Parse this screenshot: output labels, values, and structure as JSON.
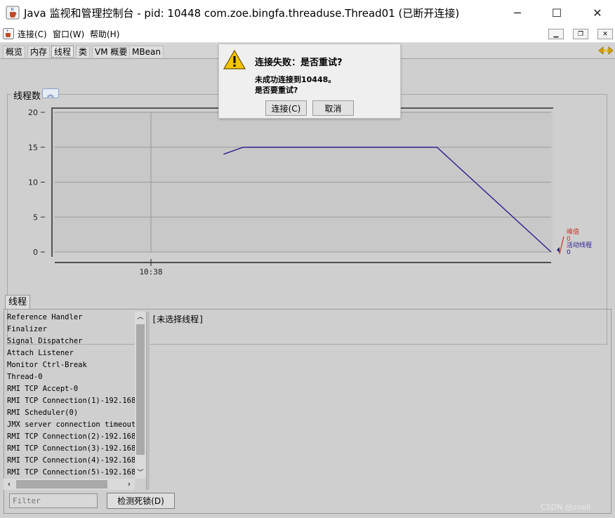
{
  "window": {
    "title": "Java 监视和管理控制台 - pid: 10448 com.zoe.bingfa.threaduse.Thread01 (已断开连接)",
    "minimize": "─",
    "maximize": "☐",
    "close": "✕"
  },
  "menu": {
    "items": [
      "连接(C)",
      "窗口(W)",
      "帮助(H)"
    ]
  },
  "tabs": [
    "概览",
    "内存",
    "线程",
    "类",
    "VM 概要",
    "MBean"
  ],
  "active_tab": "线程",
  "chart_panel": {
    "title": "线程数"
  },
  "chart_data": {
    "type": "line",
    "y_ticks": [
      "20",
      "15",
      "10",
      "5",
      "0"
    ],
    "ylim": [
      0,
      20
    ],
    "x_tick_labels": [
      "10:38"
    ],
    "series": [
      {
        "name": "活动线程",
        "color": "#2b1f8f",
        "points": [
          {
            "t": 0.34,
            "y": 14
          },
          {
            "t": 0.38,
            "y": 15
          },
          {
            "t": 0.77,
            "y": 15
          },
          {
            "t": 1.0,
            "y": 0
          }
        ]
      }
    ],
    "legend": [
      {
        "label": "峰值",
        "value": "0",
        "color": "#c0392b"
      },
      {
        "label": "活动线程",
        "value": "0",
        "color": "#2b1f8f"
      }
    ]
  },
  "threads_tab": "线程",
  "threads": [
    "Reference Handler",
    "Finalizer",
    "Signal Dispatcher",
    "Attach Listener",
    "Monitor Ctrl-Break",
    "Thread-0",
    "RMI TCP Accept-0",
    "RMI TCP Connection(1)-192.168.",
    "RMI Scheduler(0)",
    "JMX server connection timeout",
    "RMI TCP Connection(2)-192.168.",
    "RMI TCP Connection(3)-192.168.",
    "RMI TCP Connection(4)-192.168.",
    "RMI TCP Connection(5)-192.168."
  ],
  "detail_text": "[未选择线程]",
  "filter_placeholder": "Filter",
  "deadlock_button": "检测死锁(D)",
  "watermark": "CSDN @zoell",
  "dialog": {
    "title": "连接失败：是否重试?",
    "message_line1": "未成功连接到10448。",
    "message_line2": "是否要重试?",
    "connect_button": "连接(C)",
    "cancel_button": "取消"
  }
}
